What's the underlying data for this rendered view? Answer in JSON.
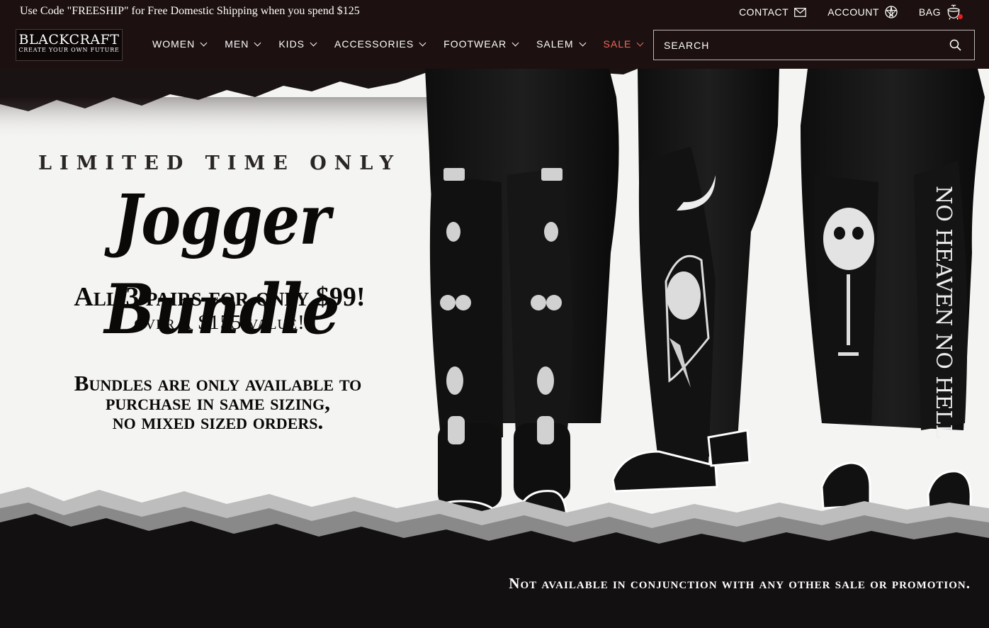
{
  "topbar": {
    "promo": "Use Code \"FREESHIP\" for Free Domestic Shipping when you spend $125",
    "contact_label": "CONTACT",
    "account_label": "ACCOUNT",
    "bag_label": "BAG"
  },
  "logo": {
    "name": "BLACKCRAFT",
    "tagline": "CREATE YOUR OWN FUTURE"
  },
  "nav": {
    "items": [
      {
        "label": "WOMEN"
      },
      {
        "label": "MEN"
      },
      {
        "label": "KIDS"
      },
      {
        "label": "ACCESSORIES"
      },
      {
        "label": "FOOTWEAR"
      },
      {
        "label": "SALEM"
      },
      {
        "label": "SALE"
      }
    ],
    "sale_color": "#ef6b5b"
  },
  "search": {
    "placeholder": "SEARCH",
    "value": ""
  },
  "hero": {
    "eyebrow": "LIMITED TIME ONLY",
    "headline": "Jogger Bundle",
    "offer": "All 3 pairs for only $99!",
    "value": "over a $155 value!",
    "terms_line1": "Bundles are only available to",
    "terms_line2": "purchase in same sizing,",
    "terms_line3": "no mixed sized orders.",
    "disclaimer": "Not available in conjunction with any other sale or promotion.",
    "print_text": "NO HEAVEN NO HELL"
  },
  "icons": {
    "contact": "mail-icon",
    "account": "pentagram-icon",
    "bag": "cauldron-bag-icon",
    "search": "search-icon"
  },
  "colors": {
    "header_bg": "#1c1010",
    "hero_bg": "#f4f4f2",
    "text_dark": "#0b0808",
    "accent_red": "#e02020"
  }
}
